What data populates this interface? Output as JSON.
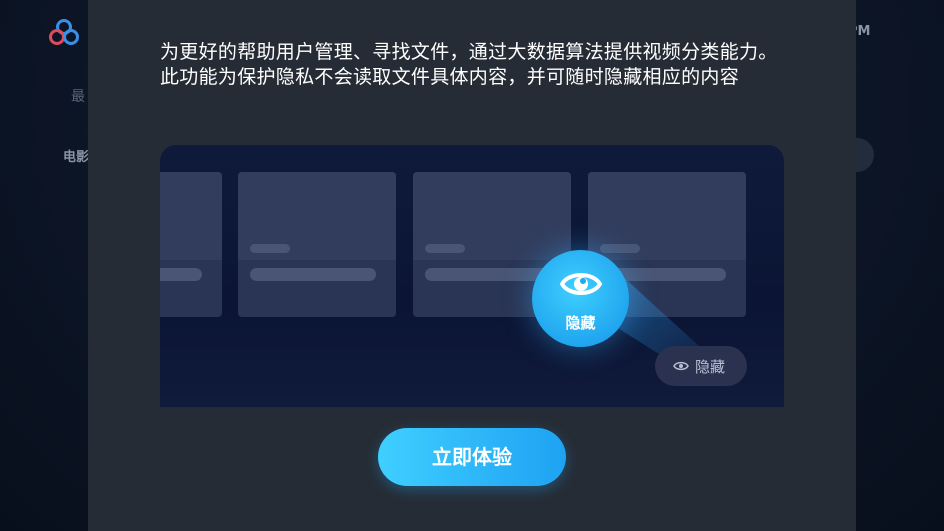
{
  "background_app": {
    "recent_label": "最",
    "movie_label": "电影",
    "time_text": "PM",
    "logo_icon": "app-logo-icon"
  },
  "dialog": {
    "description": "为更好的帮助用户管理、寻找文件，通过大数据算法提供视频分类能力。此功能为保护隐私不会读取文件具体内容，并可随时隐藏相应的内容",
    "preview": {
      "hide_circle_label": "隐藏",
      "hide_chip_label": "隐藏",
      "eye_icon": "eye-icon"
    },
    "cta_label": "立即体验"
  },
  "colors": {
    "accent_start": "#3fcfff",
    "accent_end": "#1ea2f3",
    "dialog_bg": "#262c35",
    "preview_bg": "#0f1a3a"
  }
}
